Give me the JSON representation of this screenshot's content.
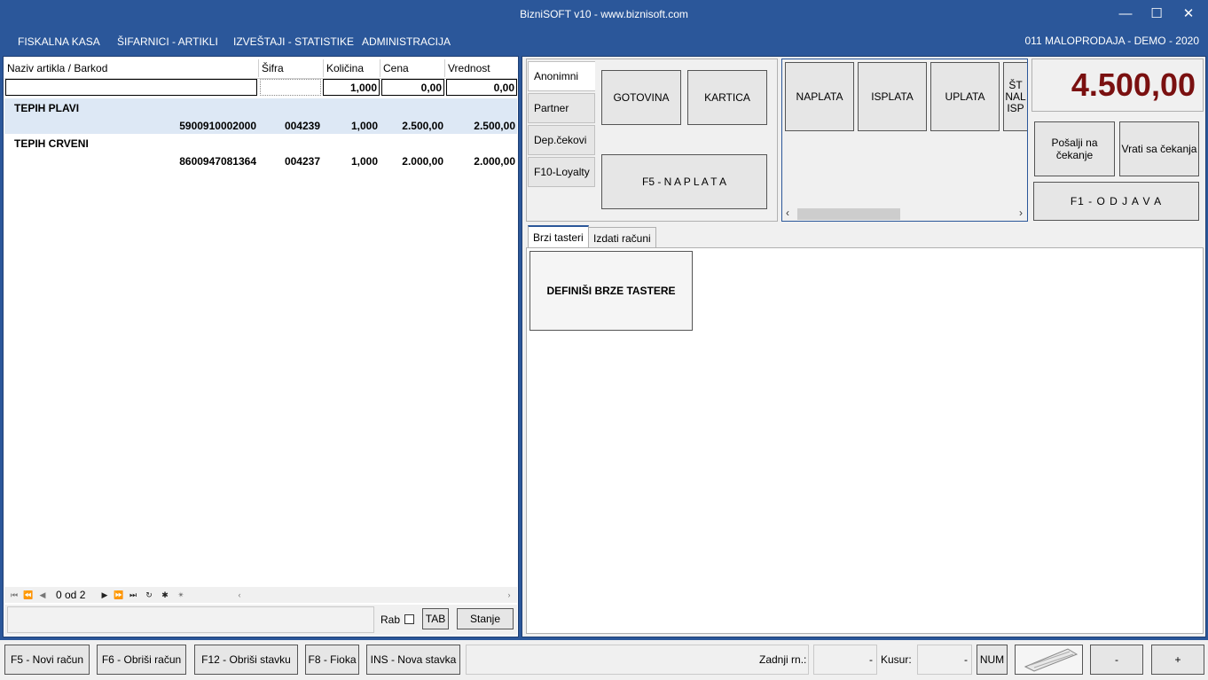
{
  "window": {
    "title": "BizniSOFT v10 - www.biznisoft.com",
    "company": "011 MALOPRODAJA - DEMO - 2020"
  },
  "menu": [
    "FISKALNA KASA",
    "ŠIFARNICI - ARTIKLI",
    "IZVEŠTAJI - STATISTIKE",
    "ADMINISTRACIJA"
  ],
  "grid": {
    "columns": [
      "Naziv artikla / Barkod",
      "Šifra",
      "Količina",
      "Cena",
      "Vrednost"
    ],
    "filter": {
      "name": "",
      "code": "",
      "qty": "1,000",
      "price": "0,00",
      "value": "0,00"
    },
    "items": [
      {
        "name": "TEPIH PLAVI",
        "barcode": "5900910002000",
        "code": "004239",
        "qty": "1,000",
        "price": "2.500,00",
        "value": "2.500,00"
      },
      {
        "name": "TEPIH CRVENI",
        "barcode": "8600947081364",
        "code": "004237",
        "qty": "1,000",
        "price": "2.000,00",
        "value": "2.000,00"
      }
    ],
    "nav_count": "0 od 2",
    "rab_label": "Rab",
    "tab_label": "TAB",
    "stanje_label": "Stanje"
  },
  "payment_tabs": [
    "Anonimni",
    "Partner",
    "Dep.čekovi",
    "F10-Loyalty"
  ],
  "payment_buttons": {
    "cash": "GOTOVINA",
    "card": "KARTICA",
    "pay": "F5 - N A P L A T A"
  },
  "action_buttons": [
    "NAPLATA",
    "ISPLATA",
    "UPLATA",
    "ŠT NAL ISP"
  ],
  "total": "4.500,00",
  "hold": {
    "send": "Pošalji na čekanje",
    "return": "Vrati sa čekanja",
    "logout": "F1 - O D J A V A"
  },
  "content_tabs": [
    "Brzi tasteri",
    "Izdati računi"
  ],
  "define_button": "DEFINIŠI BRZE TASTERE",
  "statusbar": {
    "new": "F5 - Novi račun",
    "delete_receipt": "F6 - Obriši račun",
    "delete_item": "F12 - Obriši stavku",
    "drawer": "F8 - Fioka",
    "new_item": "INS - Nova stavka",
    "last_label": "Zadnji rn.:",
    "last_value": "-",
    "change_label": "Kusur:",
    "change_value": "-",
    "num": "NUM",
    "minus": "-",
    "plus": "+"
  }
}
